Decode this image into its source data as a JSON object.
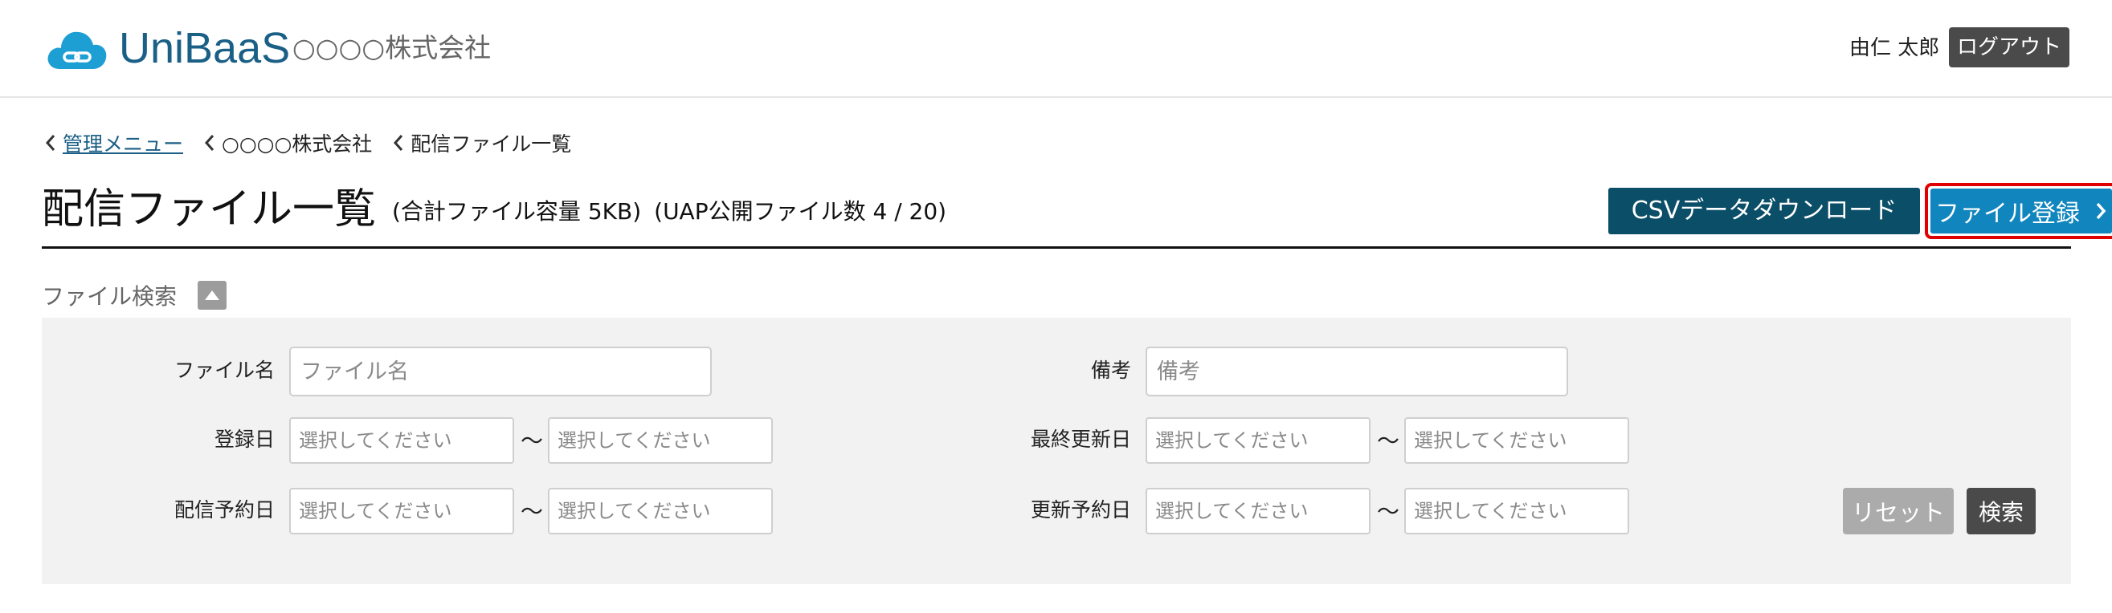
{
  "header": {
    "brand": "UniBaaS",
    "company": "○○○○株式会社",
    "user_name": "由仁 太郎",
    "logout_label": "ログアウト",
    "logo_icon": "cloud-link-icon",
    "logo_color": "#1e9fd4"
  },
  "breadcrumb": [
    {
      "label": "管理メニュー",
      "link": true
    },
    {
      "label": "○○○○株式会社",
      "link": false
    },
    {
      "label": "配信ファイル一覧",
      "link": false
    }
  ],
  "title": {
    "main": "配信ファイル一覧",
    "total_size": "(合計ファイル容量 5KB)",
    "uap_count": "(UAP公開ファイル数 4 / 20)"
  },
  "actions": {
    "csv_download": "CSVデータダウンロード",
    "register": "ファイル登録",
    "csv_color": "#0b4e68",
    "register_color": "#1185bd"
  },
  "search": {
    "section_label": "ファイル検索",
    "toggle_icon": "triangle-up-icon",
    "filename_label": "ファイル名",
    "filename_placeholder": "ファイル名",
    "note_label": "備考",
    "note_placeholder": "備考",
    "registered_label": "登録日",
    "last_updated_label": "最終更新日",
    "delivery_scheduled_label": "配信予約日",
    "update_scheduled_label": "更新予約日",
    "date_placeholder": "選択してください",
    "range_separator": "～",
    "reset_label": "リセット",
    "search_label": "検索"
  }
}
